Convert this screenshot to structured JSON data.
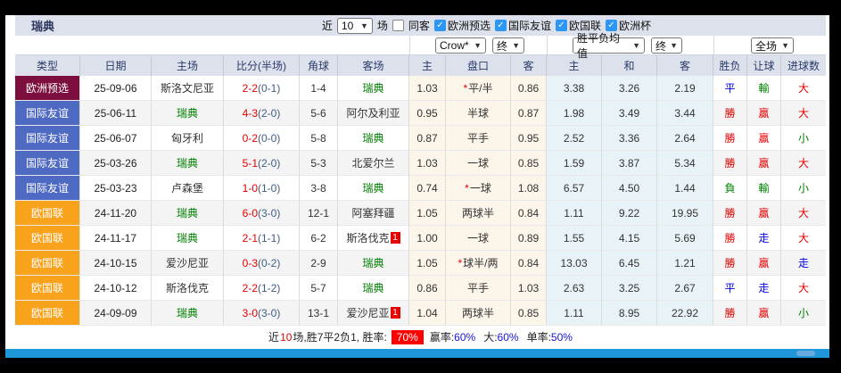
{
  "title": "瑞典",
  "toolbar": {
    "recent_label": "近",
    "recent_value": "10",
    "matches_label": "场",
    "same_away": {
      "label": "同客",
      "checked": false
    },
    "filters": [
      {
        "label": "欧洲预选",
        "checked": true
      },
      {
        "label": "国际友谊",
        "checked": true
      },
      {
        "label": "欧国联",
        "checked": true
      },
      {
        "label": "欧洲杯",
        "checked": true
      }
    ],
    "check_glyph": "✓"
  },
  "selectors": {
    "bookmaker": "Crow*",
    "bookmaker_state": "终",
    "avg_label": "胜平负均值",
    "avg_state": "终",
    "scope": "全场"
  },
  "columns": {
    "type": "类型",
    "date": "日期",
    "home": "主场",
    "score": "比分(半场)",
    "corner": "角球",
    "away": "客场",
    "odds_home": "主",
    "handicap": "盘口",
    "odds_away": "客",
    "avg_win": "主",
    "avg_draw": "和",
    "avg_lose": "客",
    "res_wdl": "胜负",
    "res_handicap": "让球",
    "res_goals": "进球数"
  },
  "rows": [
    {
      "type": "欧洲预选",
      "type_bg": "#7c0f3e",
      "date": "25-09-06",
      "home": "斯洛文尼亚",
      "home_color": "black",
      "home_card": "",
      "score": "2-2",
      "half": "(0-1)",
      "corner": "1-4",
      "away": "瑞典",
      "away_color": "green",
      "away_card": "",
      "o1": "1.03",
      "pan": "平/半",
      "pan_star": true,
      "o2": "0.86",
      "a1": "3.38",
      "a2": "3.26",
      "a3": "2.19",
      "r1": "平",
      "r1c": "blue",
      "r2": "輸",
      "r2c": "green",
      "r3": "大",
      "r3c": "red"
    },
    {
      "type": "国际友谊",
      "type_bg": "#4e6ac3",
      "date": "25-06-11",
      "home": "瑞典",
      "home_color": "green",
      "home_card": "",
      "score": "4-3",
      "half": "(2-0)",
      "corner": "5-6",
      "away": "阿尔及利亚",
      "away_color": "black",
      "away_card": "",
      "o1": "0.95",
      "pan": "半球",
      "pan_star": false,
      "o2": "0.87",
      "a1": "1.98",
      "a2": "3.49",
      "a3": "3.44",
      "r1": "勝",
      "r1c": "red",
      "r2": "贏",
      "r2c": "red",
      "r3": "大",
      "r3c": "red"
    },
    {
      "type": "国际友谊",
      "type_bg": "#4e6ac3",
      "date": "25-06-07",
      "home": "匈牙利",
      "home_color": "black",
      "home_card": "",
      "score": "0-2",
      "half": "(0-0)",
      "corner": "5-8",
      "away": "瑞典",
      "away_color": "green",
      "away_card": "",
      "o1": "0.87",
      "pan": "平手",
      "pan_star": false,
      "o2": "0.95",
      "a1": "2.52",
      "a2": "3.36",
      "a3": "2.64",
      "r1": "勝",
      "r1c": "red",
      "r2": "贏",
      "r2c": "red",
      "r3": "小",
      "r3c": "green"
    },
    {
      "type": "国际友谊",
      "type_bg": "#4e6ac3",
      "date": "25-03-26",
      "home": "瑞典",
      "home_color": "green",
      "home_card": "",
      "score": "5-1",
      "half": "(2-0)",
      "corner": "5-3",
      "away": "北爱尔兰",
      "away_color": "black",
      "away_card": "",
      "o1": "1.03",
      "pan": "一球",
      "pan_star": false,
      "o2": "0.85",
      "a1": "1.59",
      "a2": "3.87",
      "a3": "5.34",
      "r1": "勝",
      "r1c": "red",
      "r2": "贏",
      "r2c": "red",
      "r3": "大",
      "r3c": "red"
    },
    {
      "type": "国际友谊",
      "type_bg": "#4e6ac3",
      "date": "25-03-23",
      "home": "卢森堡",
      "home_color": "black",
      "home_card": "",
      "score": "1-0",
      "half": "(1-0)",
      "corner": "3-8",
      "away": "瑞典",
      "away_color": "green",
      "away_card": "",
      "o1": "0.74",
      "pan": "一球",
      "pan_star": true,
      "o2": "1.08",
      "a1": "6.57",
      "a2": "4.50",
      "a3": "1.44",
      "r1": "負",
      "r1c": "green",
      "r2": "輸",
      "r2c": "green",
      "r3": "小",
      "r3c": "green"
    },
    {
      "type": "欧国联",
      "type_bg": "#f9a21b",
      "date": "24-11-20",
      "home": "瑞典",
      "home_color": "green",
      "home_card": "",
      "score": "6-0",
      "half": "(3-0)",
      "corner": "12-1",
      "away": "阿塞拜疆",
      "away_color": "black",
      "away_card": "",
      "o1": "1.05",
      "pan": "两球半",
      "pan_star": false,
      "o2": "0.84",
      "a1": "1.11",
      "a2": "9.22",
      "a3": "19.95",
      "r1": "勝",
      "r1c": "red",
      "r2": "贏",
      "r2c": "red",
      "r3": "大",
      "r3c": "red"
    },
    {
      "type": "欧国联",
      "type_bg": "#f9a21b",
      "date": "24-11-17",
      "home": "瑞典",
      "home_color": "green",
      "home_card": "",
      "score": "2-1",
      "half": "(1-1)",
      "corner": "6-2",
      "away": "斯洛伐克",
      "away_color": "black",
      "away_card": "1",
      "o1": "1.00",
      "pan": "一球",
      "pan_star": false,
      "o2": "0.89",
      "a1": "1.55",
      "a2": "4.15",
      "a3": "5.69",
      "r1": "勝",
      "r1c": "red",
      "r2": "走",
      "r2c": "blue",
      "r3": "大",
      "r3c": "red"
    },
    {
      "type": "欧国联",
      "type_bg": "#f9a21b",
      "date": "24-10-15",
      "home": "爱沙尼亚",
      "home_color": "black",
      "home_card": "",
      "score": "0-3",
      "half": "(0-2)",
      "corner": "2-9",
      "away": "瑞典",
      "away_color": "green",
      "away_card": "",
      "o1": "1.05",
      "pan": "球半/两",
      "pan_star": true,
      "o2": "0.84",
      "a1": "13.03",
      "a2": "6.45",
      "a3": "1.21",
      "r1": "勝",
      "r1c": "red",
      "r2": "贏",
      "r2c": "red",
      "r3": "走",
      "r3c": "blue"
    },
    {
      "type": "欧国联",
      "type_bg": "#f9a21b",
      "date": "24-10-12",
      "home": "斯洛伐克",
      "home_color": "black",
      "home_card": "",
      "score": "2-2",
      "half": "(1-2)",
      "corner": "5-7",
      "away": "瑞典",
      "away_color": "green",
      "away_card": "",
      "o1": "0.86",
      "pan": "平手",
      "pan_star": false,
      "o2": "1.03",
      "a1": "2.63",
      "a2": "3.25",
      "a3": "2.67",
      "r1": "平",
      "r1c": "blue",
      "r2": "走",
      "r2c": "blue",
      "r3": "大",
      "r3c": "red"
    },
    {
      "type": "欧国联",
      "type_bg": "#f9a21b",
      "date": "24-09-09",
      "home": "瑞典",
      "home_color": "green",
      "home_card": "",
      "score": "3-0",
      "half": "(3-0)",
      "corner": "13-1",
      "away": "爱沙尼亚",
      "away_color": "black",
      "away_card": "1",
      "o1": "1.04",
      "pan": "两球半",
      "pan_star": false,
      "o2": "0.85",
      "a1": "1.11",
      "a2": "8.95",
      "a3": "22.92",
      "r1": "勝",
      "r1c": "red",
      "r2": "贏",
      "r2c": "red",
      "r3": "小",
      "r3c": "green"
    }
  ],
  "footer": {
    "seg1": "近",
    "num": "10",
    "seg2": "场,胜7平2负1, 胜率:",
    "rate": "70%",
    "s1_label": "赢率:",
    "s1_value": "60%",
    "s2_label": "大:",
    "s2_value": "60%",
    "s3_label": "单率:",
    "s3_value": "50%"
  },
  "colors": {
    "type_euro_qualifier": "#7c0f3e",
    "type_friendly": "#4e6ac3",
    "type_nations_league": "#f9a21b",
    "checkbox_checked": "#2e96f5",
    "bottom_bar": "#1f96d8",
    "result_win_red": "#e60000",
    "result_lose_green": "#008000",
    "result_draw_blue": "#0000e6",
    "header_bg": "#dce1ec",
    "handicap_col_bg": "#fbf5ea",
    "avg_col_bg": "#e8f3f8",
    "rate_badge_bg": "#ff0000"
  }
}
